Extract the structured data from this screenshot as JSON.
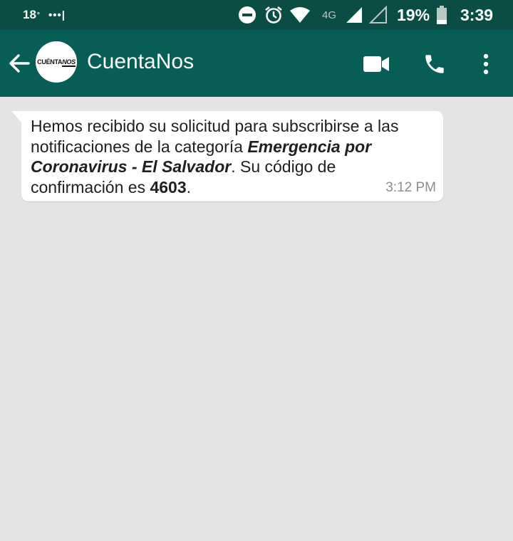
{
  "status_bar": {
    "temperature": "18",
    "degree": "°",
    "notification_dots": "•••|",
    "network_type": "4G",
    "battery_percent": "19%",
    "time": "3:39"
  },
  "header": {
    "avatar_logo_prefix": "CUÉNTA",
    "avatar_logo_suffix": "NOS",
    "contact_name": "CuentaNos"
  },
  "chat": {
    "message": {
      "text_part1": "Hemos recibido su solicitud para subscribirse a las notificaciones de la categoría ",
      "category": "Emergencia por Coronavirus - El Salvador",
      "text_part2": ". Su código de confirmación es ",
      "code": "4603",
      "text_part3": ".",
      "time": "3:12 PM"
    }
  },
  "icons": {
    "back": "arrow-left-icon",
    "video": "video-camera-icon",
    "call": "phone-icon",
    "more": "more-vert-icon",
    "dnd": "do-not-disturb-icon",
    "alarm": "alarm-clock-icon",
    "wifi": "wifi-icon",
    "signal": "signal-icon",
    "battery": "battery-icon"
  },
  "colors": {
    "status_bar": "#0b4d44",
    "header": "#075e54",
    "chat_background": "#e4e4e4",
    "bubble": "#ffffff"
  }
}
